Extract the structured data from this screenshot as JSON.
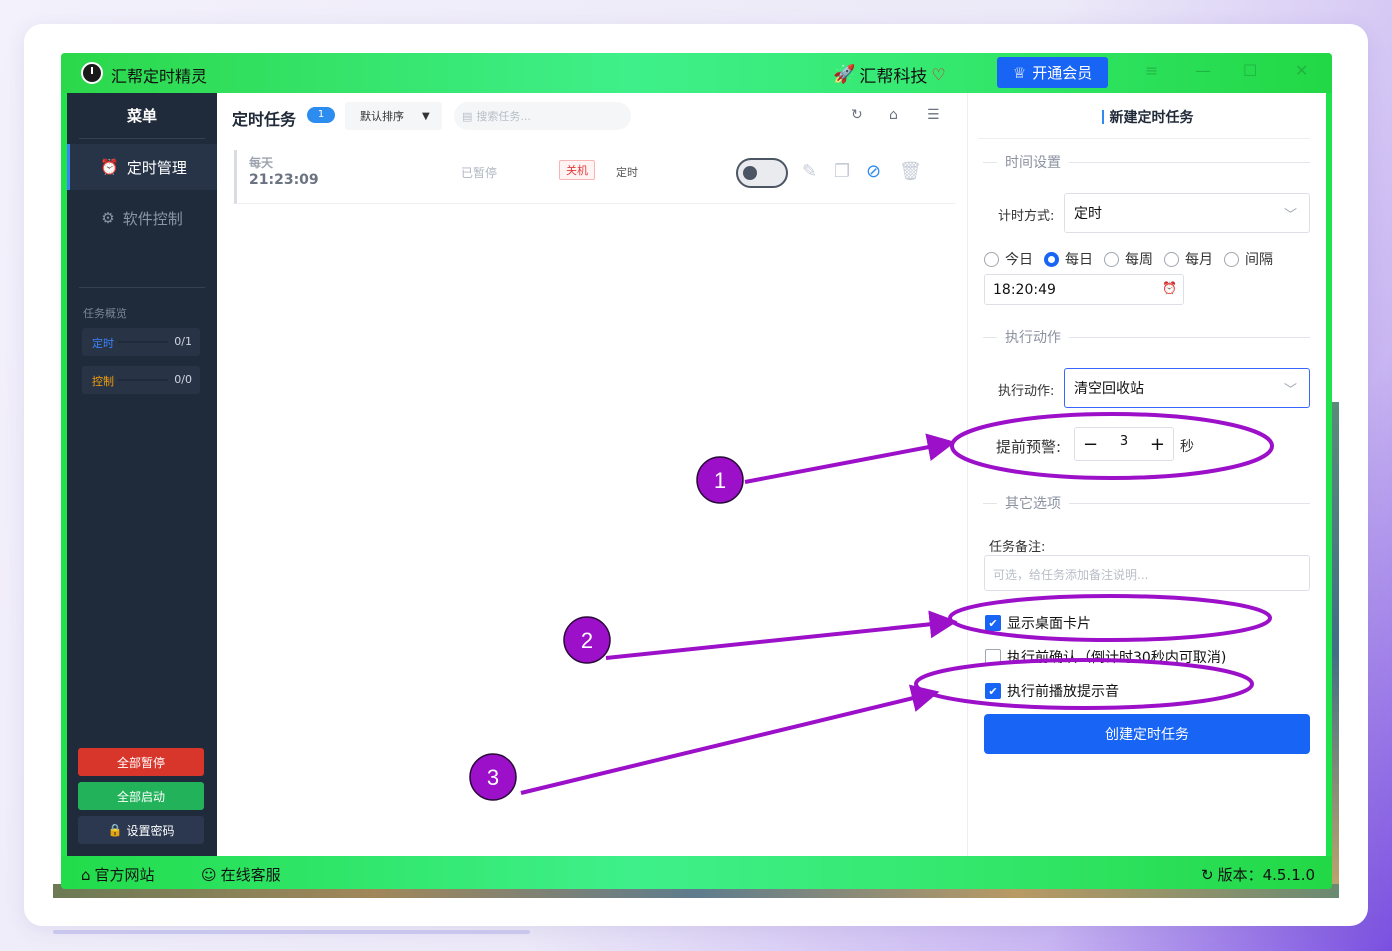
{
  "app": {
    "title": "汇帮定时精灵",
    "brand": "汇帮科技",
    "vip_label": "开通会员"
  },
  "sidebar": {
    "menu_title": "菜单",
    "nav": [
      {
        "label": "定时管理"
      },
      {
        "label": "软件控制"
      }
    ],
    "overview_title": "任务概览",
    "stats": [
      {
        "label": "定时",
        "value": "0/1",
        "color": "#3b82f6"
      },
      {
        "label": "控制",
        "value": "0/0",
        "color": "#f59e0b"
      }
    ],
    "buttons": [
      {
        "label": "全部暂停",
        "color": "#d9362b"
      },
      {
        "label": "全部启动",
        "color": "#22b35a"
      },
      {
        "label": "设置密码",
        "color": "#2b3850"
      }
    ]
  },
  "tasks": {
    "title": "定时任务",
    "count": "1",
    "sort_label": "默认排序",
    "search_placeholder": "搜索任务...",
    "rows": [
      {
        "freq": "每天",
        "time": "21:23:09",
        "status": "已暂停",
        "action": "关机",
        "type": "定时"
      }
    ]
  },
  "new_task": {
    "title": "新建定时任务",
    "section_time": "时间设置",
    "timer_mode_label": "计时方式:",
    "timer_mode_value": "定时",
    "radios": [
      {
        "label": "今日",
        "checked": false
      },
      {
        "label": "每日",
        "checked": true
      },
      {
        "label": "每周",
        "checked": false
      },
      {
        "label": "每月",
        "checked": false
      },
      {
        "label": "间隔",
        "checked": false
      }
    ],
    "time_value": "18:20:49",
    "section_action": "执行动作",
    "action_label": "执行动作:",
    "action_value": "清空回收站",
    "warn_label": "提前预警:",
    "warn_value": "3",
    "warn_unit": "秒",
    "section_other": "其它选项",
    "note_label": "任务备注:",
    "note_placeholder": "可选，给任务添加备注说明...",
    "checks": [
      {
        "label": "显示桌面卡片",
        "checked": true
      },
      {
        "label": "执行前确认（倒计时30秒内可取消)",
        "checked": false
      },
      {
        "label": "执行前播放提示音",
        "checked": true
      }
    ],
    "create_label": "创建定时任务"
  },
  "footer": {
    "website": "官方网站",
    "support": "在线客服",
    "version": "版本：4.5.1.0"
  },
  "callouts": [
    "1",
    "2",
    "3"
  ],
  "colors": {
    "accent": "#1764f5",
    "callout": "#9b10c8",
    "titlebar": "#2fe46a"
  }
}
